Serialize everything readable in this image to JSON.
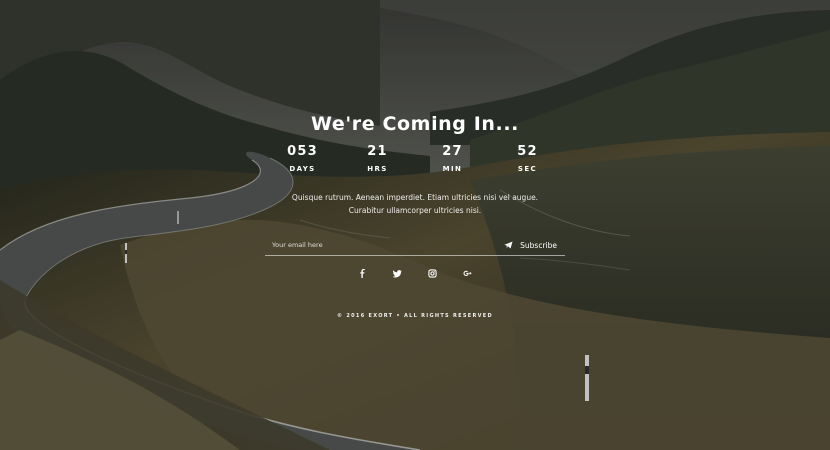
{
  "page": {
    "title": "We're Coming In...",
    "background": {
      "sky": "#63655f",
      "mountain_left": "#2d342b",
      "mountain_right": "#2f372d",
      "road": "#555957",
      "road_edge": "#d8d9d4",
      "grass": "#7e724d"
    }
  },
  "countdown": [
    {
      "value": "053",
      "label": "DAYS"
    },
    {
      "value": "21",
      "label": "HRS"
    },
    {
      "value": "27",
      "label": "MIN"
    },
    {
      "value": "52",
      "label": "SEC"
    }
  ],
  "description": {
    "line1": "Quisque rutrum. Aenean imperdiet. Etiam ultricies nisi vel augue.",
    "line2": "Curabitur ullamcorper ultricies nisi."
  },
  "subscribe": {
    "placeholder": "Your email here",
    "button_label": "Subscribe",
    "icon": "paper-plane-icon"
  },
  "social": [
    {
      "name": "facebook",
      "icon": "facebook-icon"
    },
    {
      "name": "twitter",
      "icon": "twitter-icon"
    },
    {
      "name": "instagram",
      "icon": "instagram-icon"
    },
    {
      "name": "google-plus",
      "icon": "google-plus-icon"
    }
  ],
  "footer": {
    "copyright": "© 2016 EXORT • ALL RIGHTS RESERVED"
  }
}
